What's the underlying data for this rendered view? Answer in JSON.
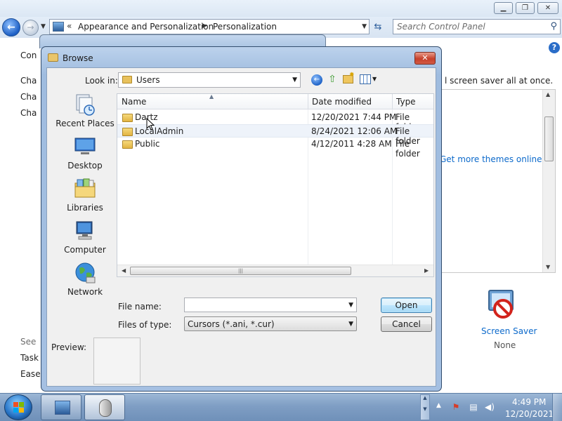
{
  "control_panel": {
    "address": {
      "crumb1": "Appearance and Personalization",
      "crumb2": "Personalization",
      "nav_arrows": "«"
    },
    "search": {
      "placeholder": "Search Control Panel"
    },
    "left_items": [
      "Con",
      "Cha",
      "Cha",
      "Cha"
    ],
    "see_also": [
      "See",
      "Task",
      "Ease o"
    ],
    "intro_fragment": "l screen saver all at once.",
    "get_more_themes": "Get more themes online",
    "screen_saver": {
      "label": "Screen Saver",
      "value": "None"
    }
  },
  "dialog": {
    "title": "Browse",
    "look_in_label": "Look in:",
    "look_in_value": "Users",
    "places": [
      {
        "label": "Recent Places",
        "icon": "recent-places-icon"
      },
      {
        "label": "Desktop",
        "icon": "desktop-icon"
      },
      {
        "label": "Libraries",
        "icon": "libraries-icon"
      },
      {
        "label": "Computer",
        "icon": "computer-icon"
      },
      {
        "label": "Network",
        "icon": "network-icon"
      }
    ],
    "columns": {
      "name": "Name",
      "date": "Date modified",
      "type": "Type"
    },
    "files": [
      {
        "name": "Dartz",
        "date": "12/20/2021 7:44 PM",
        "type": "File folder"
      },
      {
        "name": "LocalAdmin",
        "date": "8/24/2021 12:06 AM",
        "type": "File folder"
      },
      {
        "name": "Public",
        "date": "4/12/2011 4:28 AM",
        "type": "File folder"
      }
    ],
    "file_name_label": "File name:",
    "file_name_value": "",
    "files_of_type_label": "Files of type:",
    "files_of_type_value": "Cursors (*.ani, *.cur)",
    "open_label": "Open",
    "cancel_label": "Cancel",
    "preview_label": "Preview:"
  },
  "taskbar": {
    "time": "4:49 PM",
    "date": "12/20/2021"
  }
}
